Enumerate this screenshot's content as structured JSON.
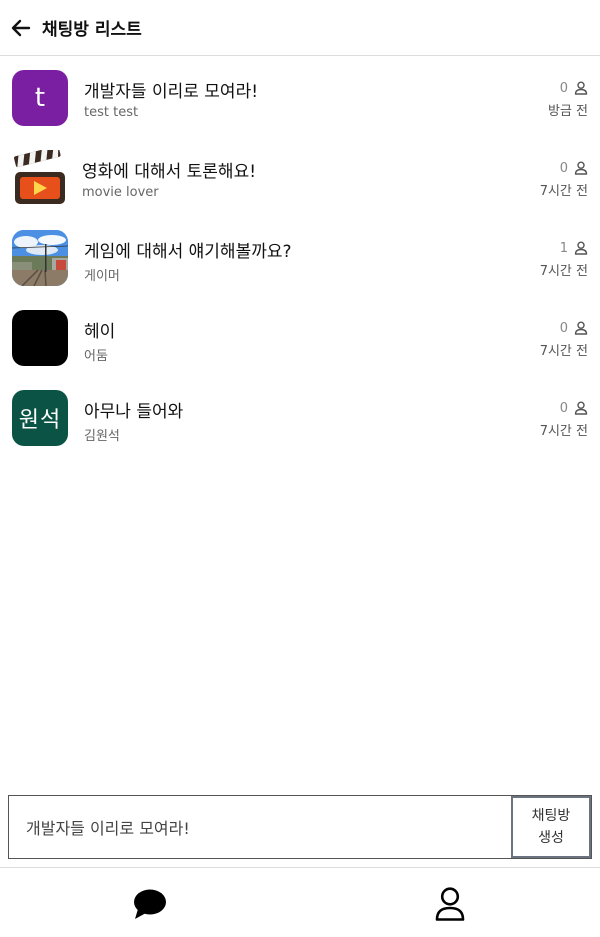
{
  "header": {
    "title": "채팅방 리스트",
    "back_icon": "arrow-left-icon"
  },
  "rooms": [
    {
      "name": "개발자들 이리로 모여라!",
      "owner": "test test",
      "count": "0",
      "time": "방금 전",
      "avatar": {
        "kind": "letter",
        "text": "t",
        "color": "#7b1fa2"
      }
    },
    {
      "name": "영화에 대해서 토론해요!",
      "owner": "movie lover",
      "count": "0",
      "time": "7시간 전",
      "avatar": {
        "kind": "icon",
        "icon": "clapperboard-icon"
      }
    },
    {
      "name": "게임에 대해서 얘기해볼까요?",
      "owner": "게이머",
      "count": "1",
      "time": "7시간 전",
      "avatar": {
        "kind": "photo",
        "icon": "railway-photo"
      }
    },
    {
      "name": "헤이",
      "owner": "어둠",
      "count": "0",
      "time": "7시간 전",
      "avatar": {
        "kind": "solid",
        "color": "#000000"
      }
    },
    {
      "name": "아무나 들어와",
      "owner": "김원석",
      "count": "0",
      "time": "7시간 전",
      "avatar": {
        "kind": "text",
        "text": "원석",
        "color": "#0b5345"
      }
    }
  ],
  "compose": {
    "value": "개발자들 이리로 모여라!",
    "button_label": "채팅방\n생성"
  },
  "nav": {
    "chat_icon": "chat-bubble-icon",
    "profile_icon": "user-icon"
  },
  "colors": {
    "border": "#dcdcdc",
    "muted": "#888888"
  }
}
